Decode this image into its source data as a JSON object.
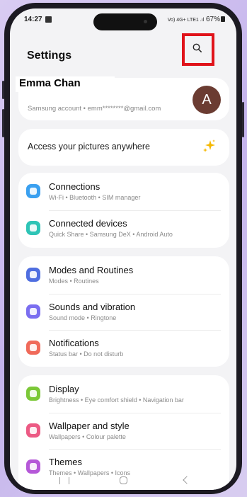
{
  "status_bar": {
    "time": "14:27",
    "network_icons": "Vo) 4G+ LTE1 .ıl",
    "battery": "67%"
  },
  "header": {
    "title": "Settings"
  },
  "account": {
    "name": "Emma Chan",
    "subtitle": "Samsung account • emm********@gmail.com",
    "avatar_letter": "A"
  },
  "promo": {
    "text": "Access your pictures anywhere"
  },
  "groups": [
    {
      "items": [
        {
          "title": "Connections",
          "subtitle": "Wi-Fi • Bluetooth • SIM manager",
          "icon": "wifi-icon",
          "color": "#3aa0f0"
        },
        {
          "title": "Connected devices",
          "subtitle": "Quick Share • Samsung DeX • Android Auto",
          "icon": "devices-icon",
          "color": "#2ec4b6"
        }
      ]
    },
    {
      "items": [
        {
          "title": "Modes and Routines",
          "subtitle": "Modes • Routines",
          "icon": "modes-icon",
          "color": "#4f6ee0"
        },
        {
          "title": "Sounds and vibration",
          "subtitle": "Sound mode • Ringtone",
          "icon": "sound-icon",
          "color": "#7b6ef0"
        },
        {
          "title": "Notifications",
          "subtitle": "Status bar • Do not disturb",
          "icon": "notifications-icon",
          "color": "#f06a5a"
        }
      ]
    },
    {
      "items": [
        {
          "title": "Display",
          "subtitle": "Brightness • Eye comfort shield • Navigation bar",
          "icon": "display-icon",
          "color": "#7cc838"
        },
        {
          "title": "Wallpaper and style",
          "subtitle": "Wallpapers • Colour palette",
          "icon": "wallpaper-icon",
          "color": "#ec5a84"
        },
        {
          "title": "Themes",
          "subtitle": "Themes • Wallpapers • Icons",
          "icon": "themes-icon",
          "color": "#b558d8"
        }
      ]
    }
  ],
  "colors": {
    "highlight": "#e0131a",
    "avatar_bg": "#6b3c32",
    "sparkle": "#f5b800"
  }
}
